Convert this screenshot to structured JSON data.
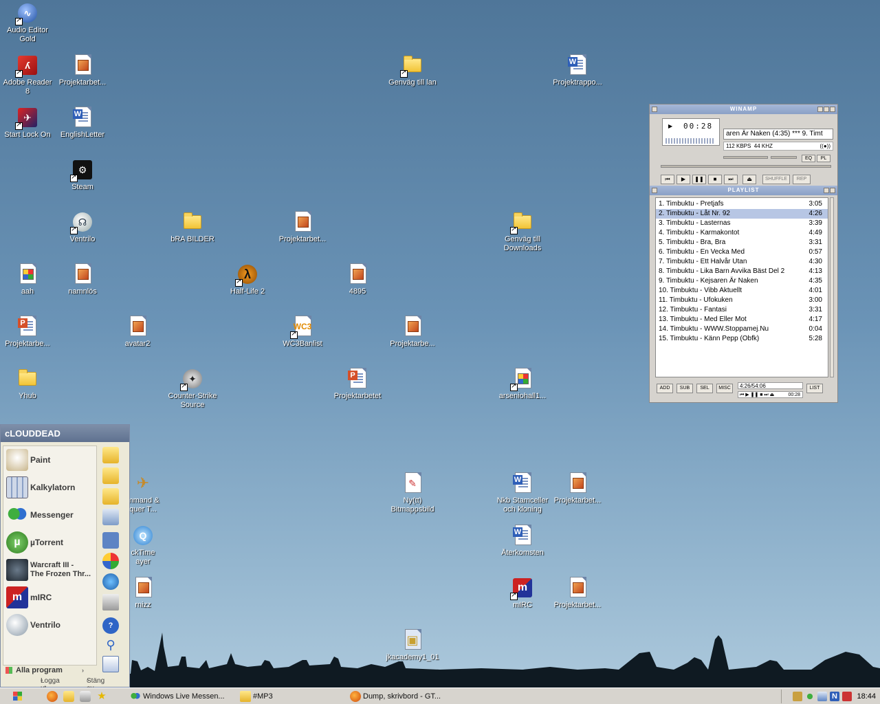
{
  "desktop": {
    "icons": [
      {
        "label": "Audio Editor\nGold"
      },
      {
        "label": "Adobe Reader\n8"
      },
      {
        "label": "Projektarbet..."
      },
      {
        "label": "Genväg till lan"
      },
      {
        "label": "Projektrappo..."
      },
      {
        "label": "Start Lock On"
      },
      {
        "label": "EnglishLetter"
      },
      {
        "label": "Steam"
      },
      {
        "label": "Ventrilo"
      },
      {
        "label": "bRA BILDER"
      },
      {
        "label": "Projektarbet..."
      },
      {
        "label": "Genväg till\nDownloads"
      },
      {
        "label": "aah"
      },
      {
        "label": "namnlös"
      },
      {
        "label": "Half-Life 2"
      },
      {
        "label": "4895"
      },
      {
        "label": "Projektarbe..."
      },
      {
        "label": "avatar2"
      },
      {
        "label": "WC3Banlist"
      },
      {
        "label": "Projektarbe..."
      },
      {
        "label": "Yhub"
      },
      {
        "label": "Counter-Strike\nSource"
      },
      {
        "label": "Projektarbetet"
      },
      {
        "label": "arseniohall1..."
      },
      {
        "label": "mmand &\nquer T..."
      },
      {
        "label": "Ny(tt)\nBitmappsbild"
      },
      {
        "label": "Nkb Stamceller\noch kloning"
      },
      {
        "label": "Projektarbet..."
      },
      {
        "label": "ckTime\nayer"
      },
      {
        "label": "Återkomsten"
      },
      {
        "label": "rnizz"
      },
      {
        "label": "mIRC"
      },
      {
        "label": "Projektarbet..."
      },
      {
        "label": "jkacademy1_01"
      }
    ]
  },
  "winamp": {
    "title": "WINAMP",
    "time": "00:28",
    "song": "aren Är Naken (4:35) *** 9. Timt",
    "kbps": "112 KBPS",
    "khz": "44 KHZ",
    "stereo": "((●))",
    "eq": "EQ",
    "pl": "PL",
    "buttons": {
      "prev": "⏮",
      "play": "▶",
      "pause": "❚❚",
      "stop": "■",
      "next": "⏭",
      "eject": "⏏"
    },
    "shuffle": "SHUFFLE",
    "repeat": "REP",
    "playlist_title": "PLAYLIST",
    "playlist": [
      {
        "title": "1. Timbuktu - Pretjafs",
        "dur": "3:05"
      },
      {
        "title": "2. Timbuktu - Låt Nr. 92",
        "dur": "4:26"
      },
      {
        "title": "3. Timbuktu - Lasternas",
        "dur": "3:39"
      },
      {
        "title": "4. Timbuktu - Karmakontot",
        "dur": "4:49"
      },
      {
        "title": "5. Timbuktu - Bra, Bra",
        "dur": "3:31"
      },
      {
        "title": "6. Timbuktu - En Vecka Med",
        "dur": "0:57"
      },
      {
        "title": "7. Timbuktu - Ett Halvår Utan",
        "dur": "4:30"
      },
      {
        "title": "8. Timbuktu - Lika Barn Avvika Bäst Del 2",
        "dur": "4:13"
      },
      {
        "title": "9. Timbuktu - Kejsaren Är Naken",
        "dur": "4:35"
      },
      {
        "title": "10. Timbuktu - Vibb Aktuellt",
        "dur": "4:01"
      },
      {
        "title": "11. Timbuktu - Ufokuken",
        "dur": "3:00"
      },
      {
        "title": "12. Timbuktu - Fantasi",
        "dur": "3:31"
      },
      {
        "title": "13. Timbuktu - Med Eller Mot",
        "dur": "4:17"
      },
      {
        "title": "14. Timbuktu - WWW.Stoppamej.Nu",
        "dur": "0:04"
      },
      {
        "title": "15. Timbuktu - Känn Pepp (Obfk)",
        "dur": "5:28"
      }
    ],
    "pl_buttons": {
      "add": "ADD",
      "sub": "SUB",
      "sel": "SEL",
      "misc": "MISC",
      "list": "LIST"
    },
    "pl_total": "4:26/54:06",
    "pl_controls": "⏮ ▶ ❚❚ ■ ⏭ ⏏",
    "pl_pos": "00:28"
  },
  "startmenu": {
    "user": "cLOUDDEAD",
    "items": [
      {
        "label": "Paint"
      },
      {
        "label": "Kalkylatorn"
      },
      {
        "label": "Messenger"
      },
      {
        "label": "µTorrent"
      },
      {
        "label": "Warcraft III -\nThe Frozen Thr..."
      },
      {
        "label": "mIRC"
      },
      {
        "label": "Ventrilo"
      }
    ],
    "all_programs": "Alla program",
    "logoff": "Logga ut",
    "shutdown": "Stäng av"
  },
  "taskbar": {
    "tasks": [
      {
        "label": "Windows Live Messen..."
      },
      {
        "label": "#MP3"
      },
      {
        "label": "Dump, skrivbord - GT..."
      }
    ],
    "clock": "18:44",
    "tray_n": "N"
  }
}
